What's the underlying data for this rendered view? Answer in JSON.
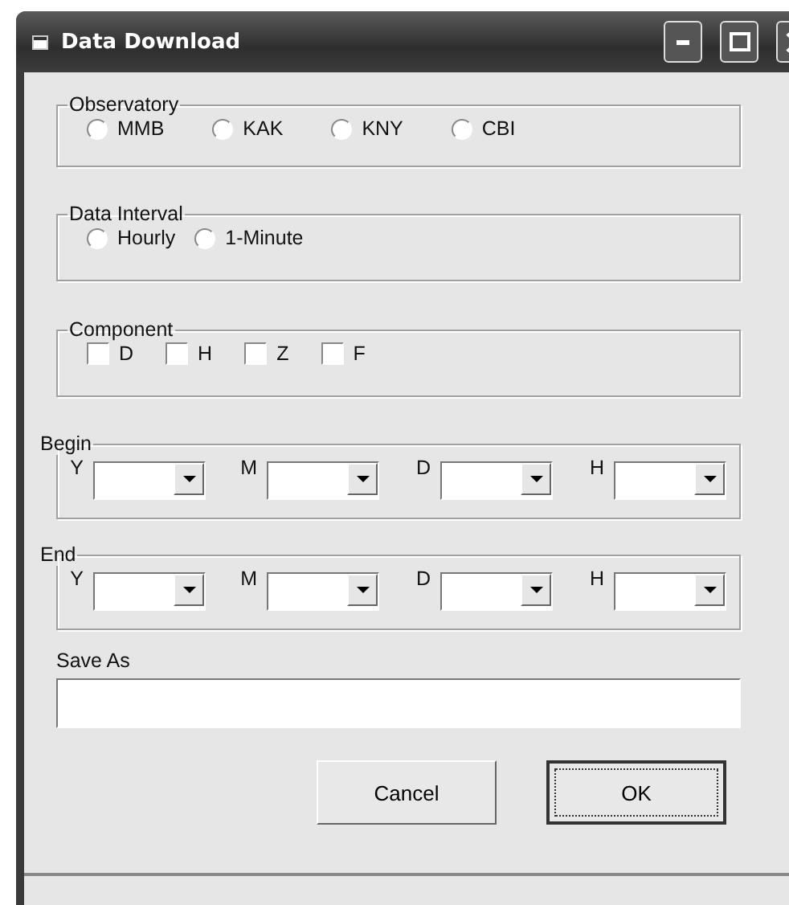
{
  "window": {
    "title": "Data Download"
  },
  "observatory": {
    "label": "Observatory",
    "options": [
      {
        "label": "MMB",
        "selected": false
      },
      {
        "label": "KAK",
        "selected": false
      },
      {
        "label": "KNY",
        "selected": false
      },
      {
        "label": "CBI",
        "selected": false
      }
    ]
  },
  "data_interval": {
    "label": "Data Interval",
    "options": [
      {
        "label": "Hourly",
        "selected": false
      },
      {
        "label": "1-Minute",
        "selected": false
      }
    ]
  },
  "component": {
    "label": "Component",
    "options": [
      {
        "label": "D",
        "checked": false
      },
      {
        "label": "H",
        "checked": false
      },
      {
        "label": "Z",
        "checked": false
      },
      {
        "label": "F",
        "checked": false
      }
    ]
  },
  "begin": {
    "label": "Begin",
    "fields": [
      {
        "label": "Y"
      },
      {
        "label": "M"
      },
      {
        "label": "D"
      },
      {
        "label": "H"
      }
    ]
  },
  "end": {
    "label": "End",
    "fields": [
      {
        "label": "Y"
      },
      {
        "label": "M"
      },
      {
        "label": "D"
      },
      {
        "label": "H"
      }
    ]
  },
  "save_as": {
    "label": "Save As"
  },
  "buttons": [
    {
      "label": "Cancel",
      "default": false
    },
    {
      "label": "OK",
      "default": true
    }
  ]
}
